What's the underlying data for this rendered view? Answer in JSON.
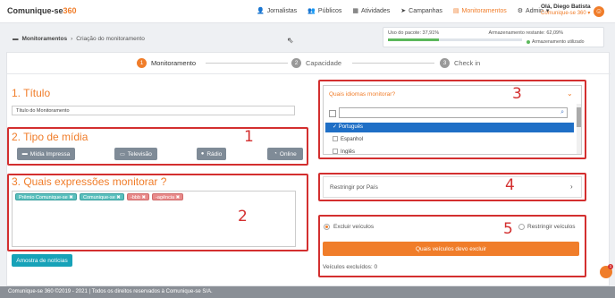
{
  "header": {
    "logo_main": "Comunique-se",
    "logo_accent": "360",
    "nav": [
      {
        "label": "Jornalistas",
        "icon": "user-icon"
      },
      {
        "label": "Públicos",
        "icon": "users-icon"
      },
      {
        "label": "Atividades",
        "icon": "calendar-icon"
      },
      {
        "label": "Campanhas",
        "icon": "send-icon"
      },
      {
        "label": "Monitoramentos",
        "icon": "monitor-icon",
        "active": true
      },
      {
        "label": "Admin",
        "icon": "gear-icon"
      }
    ],
    "user_greeting": "Olá, Diego Batista",
    "user_company": "Comunique-se 360",
    "avatar_glyph": "☺"
  },
  "breadcrumb": {
    "parent": "Monitoramentos",
    "separator": "›",
    "current": "Criação do monitoramento"
  },
  "usage": {
    "package_label": "Uso do pacote: 37,91%",
    "package_fraction": 0.3791,
    "remaining_label": "Armazenamento restante: 62,09%",
    "used_legend": "Armazenamento utilizado"
  },
  "steps": [
    {
      "num": "1",
      "label": "Monitoramento",
      "active": true
    },
    {
      "num": "2",
      "label": "Capacidade"
    },
    {
      "num": "3",
      "label": "Check in"
    }
  ],
  "form": {
    "title_heading": "1. Título",
    "title_value": "Título do Monitoramento",
    "media_heading": "2. Tipo de mídia",
    "media_buttons": [
      {
        "label": "Mídia Impressa",
        "icon": "newspaper-icon",
        "glyph": "▬"
      },
      {
        "label": "Televisão",
        "icon": "tv-icon",
        "glyph": "▭"
      },
      {
        "label": "Rádio",
        "icon": "microphone-icon",
        "glyph": "●"
      },
      {
        "label": "Online",
        "icon": "wifi-icon",
        "glyph": "◔"
      }
    ],
    "expr_heading": "3. Quais expressões monitorar ?",
    "expressions": [
      {
        "text": "Prêmio Comunique-se",
        "kind": "positive"
      },
      {
        "text": "Comunique-se",
        "kind": "positive"
      },
      {
        "text": "-bbb",
        "kind": "negative"
      },
      {
        "text": "-agência",
        "kind": "negative"
      }
    ],
    "sample_button": "Amostra de notícias"
  },
  "languages": {
    "heading": "Quais idiomas monitorar?",
    "search_value": "",
    "options": [
      {
        "label": "Português",
        "selected": true
      },
      {
        "label": "Espanhol",
        "selected": false
      },
      {
        "label": "Inglês",
        "selected": false
      }
    ]
  },
  "countries": {
    "label": "Restringir por País"
  },
  "vehicles": {
    "exclude_label": "Excluir veículos",
    "restrict_label": "Restringir veículos",
    "button": "Quais veículos devo excluir",
    "excluded_count": "Veículos excluídos: 0"
  },
  "annotations": [
    "1",
    "2",
    "3",
    "4",
    "5"
  ],
  "footer": "Comunique-se 360 ©2019 - 2021 | Todos os direitos reservados à Comunique-se S/A.",
  "chat_badge": "1",
  "colors": {
    "accent": "#f07d2a",
    "annotation": "#d32f2f",
    "teal": "#17a2b8"
  }
}
